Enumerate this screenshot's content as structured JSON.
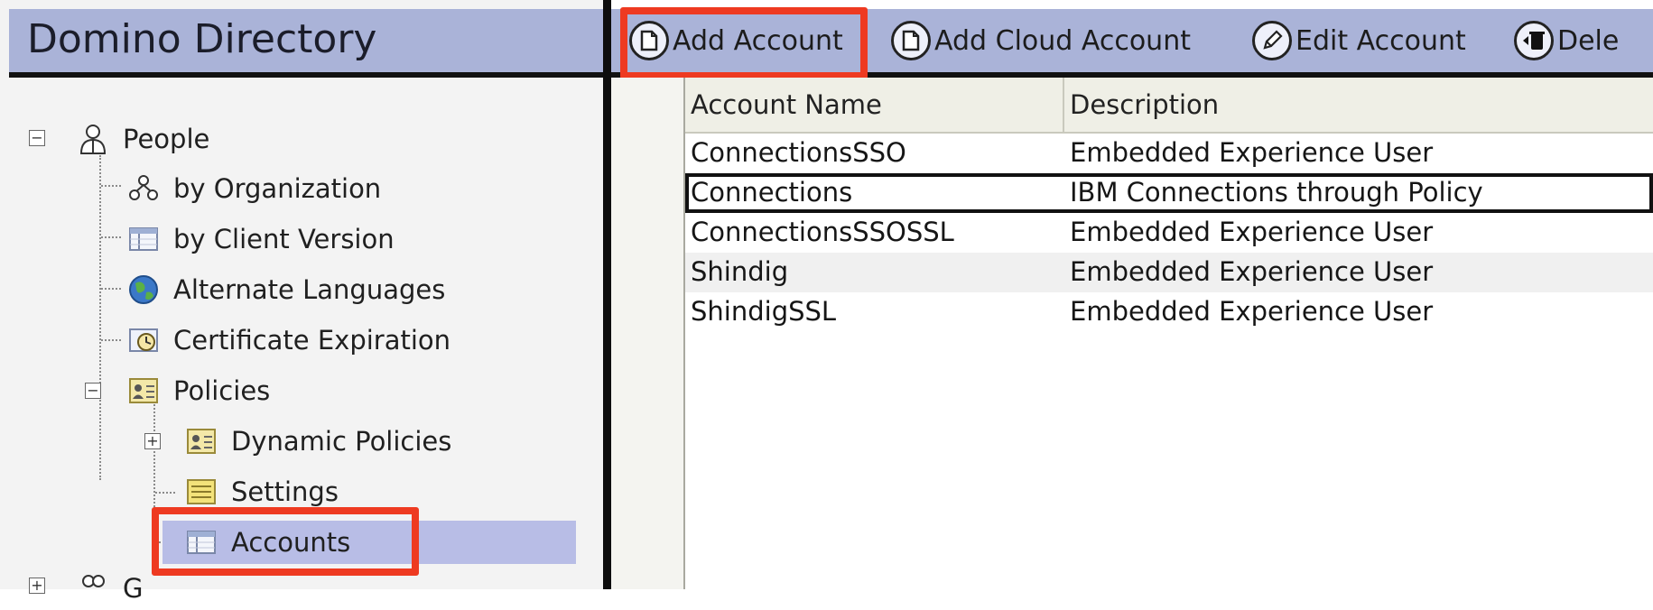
{
  "left_pane": {
    "title": "Domino Directory",
    "tree": {
      "people": "People",
      "by_organization": "by Organization",
      "by_client_version": "by Client Version",
      "alternate_languages": "Alternate Languages",
      "certificate_expiration": "Certificate Expiration",
      "policies": "Policies",
      "dynamic_policies": "Dynamic Policies",
      "settings": "Settings",
      "accounts": "Accounts",
      "groups_partial": "G"
    },
    "selected": "Accounts"
  },
  "toolbar": {
    "add_account": "Add Account",
    "add_cloud_account": "Add Cloud Account",
    "edit_account": "Edit Account",
    "delete_partial": "Dele"
  },
  "view": {
    "columns": [
      "Account Name",
      "Description"
    ],
    "rows": [
      {
        "name": "ConnectionsSSO",
        "description": "Embedded Experience User"
      },
      {
        "name": "Connections",
        "description": "IBM Connections through Policy"
      },
      {
        "name": "ConnectionsSSOSSL",
        "description": "Embedded Experience User"
      },
      {
        "name": "Shindig",
        "description": "Embedded Experience User"
      },
      {
        "name": "ShindigSSL",
        "description": "Embedded Experience User"
      }
    ]
  },
  "colors": {
    "header_bg": "#aab3d8",
    "selection_bg": "#b8bde6",
    "highlight_box": "#ee3a21"
  }
}
